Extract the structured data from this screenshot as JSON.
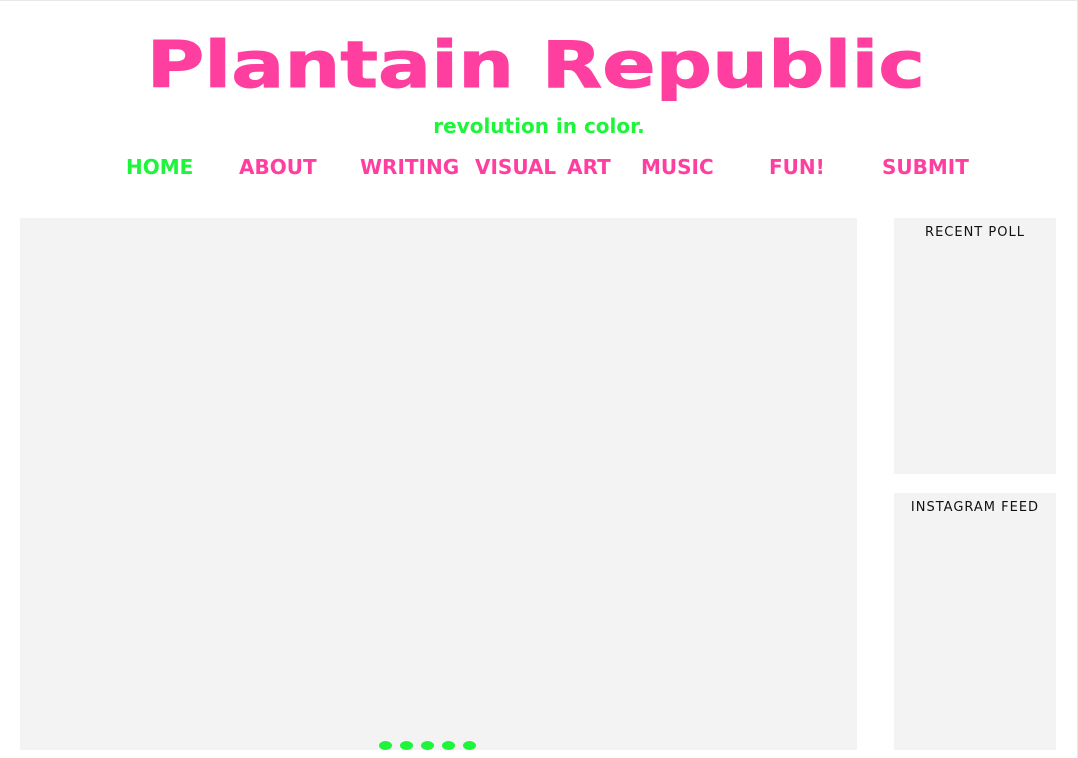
{
  "site": {
    "title": "Plantain Republic",
    "tagline": "revolution in color."
  },
  "nav": {
    "items": [
      {
        "label": "HOME",
        "active": true
      },
      {
        "label": "ABOUT",
        "active": false
      },
      {
        "label": "WRITING",
        "active": false
      },
      {
        "label": "VISUAL ART",
        "active": false
      },
      {
        "label": "MUSIC",
        "active": false
      },
      {
        "label": "FUN!",
        "active": false
      },
      {
        "label": "SUBMIT",
        "active": false
      }
    ]
  },
  "slideshow": {
    "dot_count": 5
  },
  "sidebar": {
    "poll_title": "RECENT POLL",
    "instagram_title": "INSTAGRAM FEED"
  },
  "colors": {
    "brand_pink": "#ff3fa0",
    "accent_green": "#1cf53a",
    "panel_gray": "#f3f3f3"
  }
}
